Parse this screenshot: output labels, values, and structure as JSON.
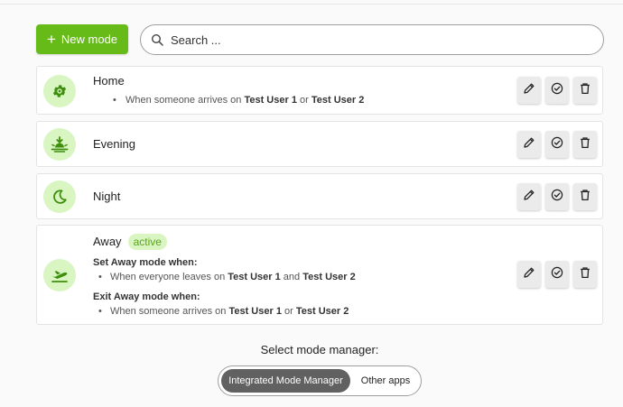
{
  "toolbar": {
    "new_mode_label": "New mode",
    "search_placeholder": "Search ..."
  },
  "colors": {
    "accent": "#66bb18",
    "accent_light": "#d9f5c2",
    "icon_green": "#3f8f0e"
  },
  "modes": [
    {
      "name": "Home",
      "icon": "gear-icon",
      "conditions": [
        {
          "text_prefix": "When someone arrives on ",
          "user1": "Test User 1",
          "join": " or ",
          "user2": "Test User 2"
        }
      ]
    },
    {
      "name": "Evening",
      "icon": "sunset-icon"
    },
    {
      "name": "Night",
      "icon": "moon-icon"
    },
    {
      "name": "Away",
      "icon": "plane-departure-icon",
      "badge": "active",
      "set_heading": "Set Away mode when:",
      "set_condition": {
        "text_prefix": "When everyone leaves on ",
        "user1": "Test User 1",
        "join": " and ",
        "user2": "Test User 2"
      },
      "exit_heading": "Exit Away mode when:",
      "exit_condition": {
        "text_prefix": "When someone arrives on ",
        "user1": "Test User 1",
        "join": " or ",
        "user2": "Test User 2"
      }
    }
  ],
  "actions": {
    "edit_icon": "pencil-icon",
    "activate_icon": "check-circle-icon",
    "delete_icon": "trash-icon"
  },
  "manager": {
    "label": "Select mode manager:",
    "options": [
      "Integrated Mode Manager",
      "Other apps"
    ],
    "selected": "Integrated Mode Manager"
  }
}
